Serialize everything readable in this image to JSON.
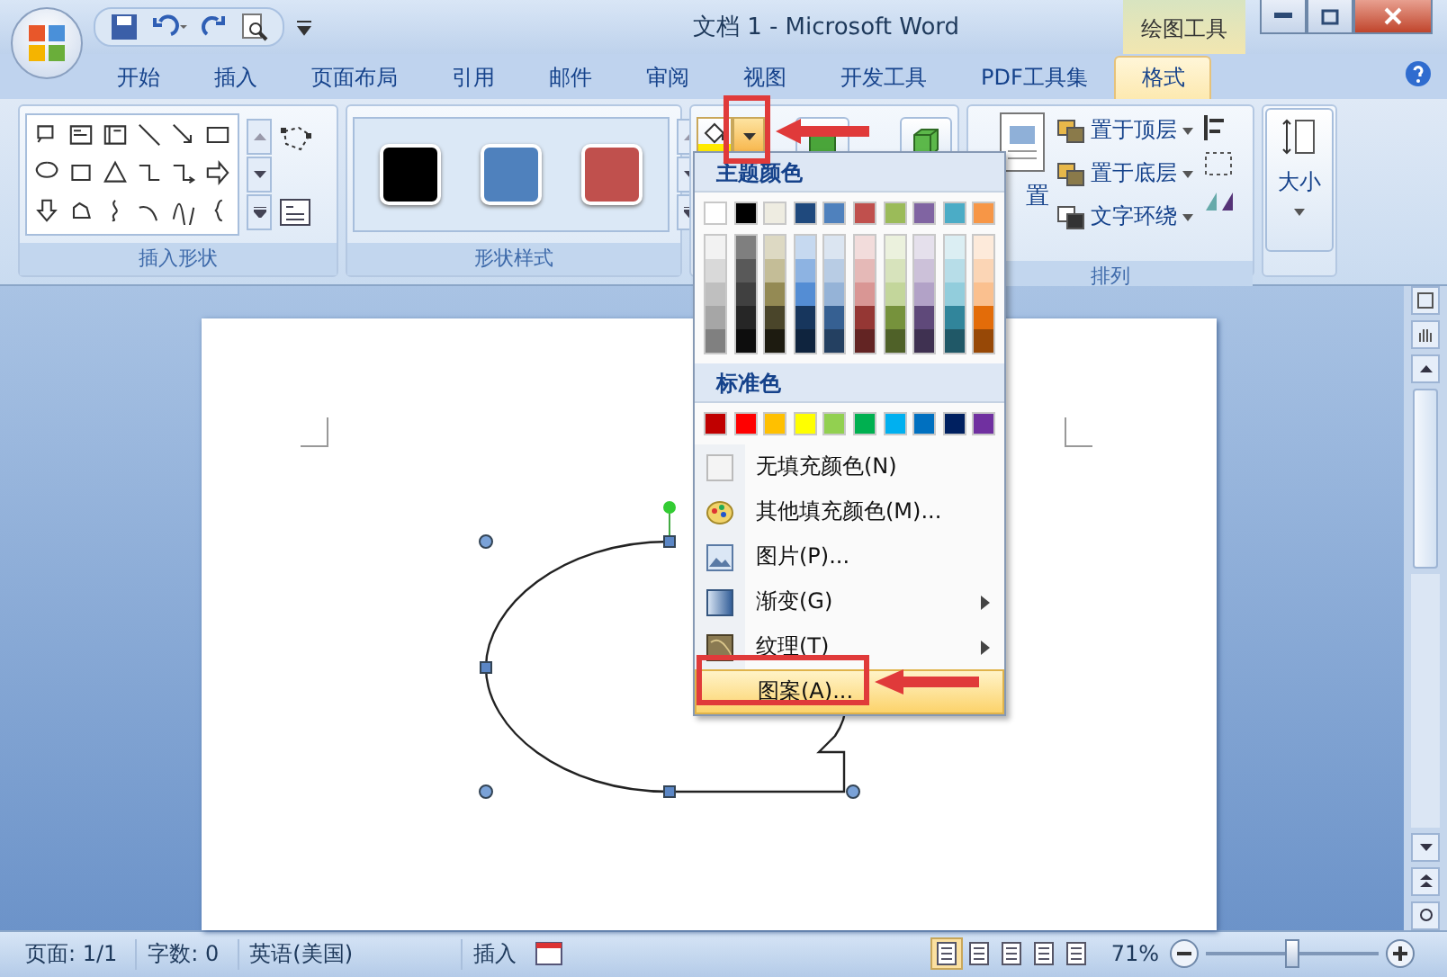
{
  "title_bar": {
    "title": "文档 1 - Microsoft Word",
    "context_tab": "绘图工具"
  },
  "tabs": [
    {
      "label": "开始",
      "selected": false
    },
    {
      "label": "插入",
      "selected": false
    },
    {
      "label": "页面布局",
      "selected": false
    },
    {
      "label": "引用",
      "selected": false
    },
    {
      "label": "邮件",
      "selected": false
    },
    {
      "label": "审阅",
      "selected": false
    },
    {
      "label": "视图",
      "selected": false
    },
    {
      "label": "开发工具",
      "selected": false
    },
    {
      "label": "PDF工具集",
      "selected": false
    },
    {
      "label": "格式",
      "selected": true
    }
  ],
  "ribbon": {
    "shapes_group": {
      "label": "插入形状"
    },
    "styles_group": {
      "label": "形状样式",
      "swatches": [
        {
          "color": "#000000"
        },
        {
          "color": "#4f81bd"
        },
        {
          "color": "#c0504d"
        }
      ]
    },
    "arrange_group": {
      "label": "排列",
      "position_label": "置",
      "items": [
        {
          "label": "置于顶层"
        },
        {
          "label": "置于底层"
        },
        {
          "label": "文字环绕"
        }
      ]
    },
    "size_group": {
      "button": "大小"
    }
  },
  "fill_menu": {
    "theme_heading": "主题颜色",
    "theme_colors": [
      {
        "color": "#ffffff",
        "shades": [
          {
            "color": "#f2f2f2"
          },
          {
            "color": "#d9d9d9"
          },
          {
            "color": "#bfbfbf"
          },
          {
            "color": "#a6a6a6"
          },
          {
            "color": "#808080"
          }
        ]
      },
      {
        "color": "#000000",
        "shades": [
          {
            "color": "#7f7f7f"
          },
          {
            "color": "#595959"
          },
          {
            "color": "#404040"
          },
          {
            "color": "#262626"
          },
          {
            "color": "#0d0d0d"
          }
        ]
      },
      {
        "color": "#eeece1",
        "shades": [
          {
            "color": "#ddd9c3"
          },
          {
            "color": "#c4bd97"
          },
          {
            "color": "#948a54"
          },
          {
            "color": "#4a452a"
          },
          {
            "color": "#1d1b10"
          }
        ]
      },
      {
        "color": "#1f497d",
        "shades": [
          {
            "color": "#c6d9f0"
          },
          {
            "color": "#8db3e2"
          },
          {
            "color": "#548dd4"
          },
          {
            "color": "#17365d"
          },
          {
            "color": "#0f243e"
          }
        ]
      },
      {
        "color": "#4f81bd",
        "shades": [
          {
            "color": "#dbe5f1"
          },
          {
            "color": "#b8cce4"
          },
          {
            "color": "#95b3d7"
          },
          {
            "color": "#366092"
          },
          {
            "color": "#244061"
          }
        ]
      },
      {
        "color": "#c0504d",
        "shades": [
          {
            "color": "#f2dcdb"
          },
          {
            "color": "#e5b9b7"
          },
          {
            "color": "#d99694"
          },
          {
            "color": "#953734"
          },
          {
            "color": "#632423"
          }
        ]
      },
      {
        "color": "#9bbb59",
        "shades": [
          {
            "color": "#ebf1dd"
          },
          {
            "color": "#d7e3bc"
          },
          {
            "color": "#c3d69b"
          },
          {
            "color": "#76923c"
          },
          {
            "color": "#4f6128"
          }
        ]
      },
      {
        "color": "#8064a2",
        "shades": [
          {
            "color": "#e5e0ec"
          },
          {
            "color": "#ccc1d9"
          },
          {
            "color": "#b2a2c7"
          },
          {
            "color": "#5f497a"
          },
          {
            "color": "#3f3151"
          }
        ]
      },
      {
        "color": "#4bacc6",
        "shades": [
          {
            "color": "#dbeef3"
          },
          {
            "color": "#b7dde8"
          },
          {
            "color": "#92cddc"
          },
          {
            "color": "#31859b"
          },
          {
            "color": "#205867"
          }
        ]
      },
      {
        "color": "#f79646",
        "shades": [
          {
            "color": "#fdeada"
          },
          {
            "color": "#fbd5b5"
          },
          {
            "color": "#fac08f"
          },
          {
            "color": "#e36c09"
          },
          {
            "color": "#974806"
          }
        ]
      }
    ],
    "standard_heading": "标准色",
    "standard_colors": [
      {
        "color": "#c00000"
      },
      {
        "color": "#ff0000"
      },
      {
        "color": "#ffc000"
      },
      {
        "color": "#ffff00"
      },
      {
        "color": "#92d050"
      },
      {
        "color": "#00b050"
      },
      {
        "color": "#00b0f0"
      },
      {
        "color": "#0070c0"
      },
      {
        "color": "#002060"
      },
      {
        "color": "#7030a0"
      }
    ],
    "items": [
      {
        "kind": "none",
        "label": "无填充颜色(N)",
        "submenu": false,
        "selected": false
      },
      {
        "kind": "palette",
        "label": "其他填充颜色(M)...",
        "submenu": false,
        "selected": false
      },
      {
        "kind": "picture",
        "label": "图片(P)...",
        "submenu": false,
        "selected": false
      },
      {
        "kind": "gradient",
        "label": "渐变(G)",
        "submenu": true,
        "selected": false
      },
      {
        "kind": "texture",
        "label": "纹理(T)",
        "submenu": true,
        "selected": false
      },
      {
        "kind": "pattern",
        "label": "图案(A)...",
        "submenu": false,
        "selected": true
      }
    ]
  },
  "status_bar": {
    "page": "页面: 1/1",
    "words": "字数: 0",
    "language": "英语(美国)",
    "mode": "插入",
    "views": [
      {
        "selected": true
      },
      {
        "selected": false
      },
      {
        "selected": false
      },
      {
        "selected": false
      },
      {
        "selected": false
      }
    ],
    "zoom": "71%",
    "zoom_slider": {
      "level": 0.5
    }
  }
}
